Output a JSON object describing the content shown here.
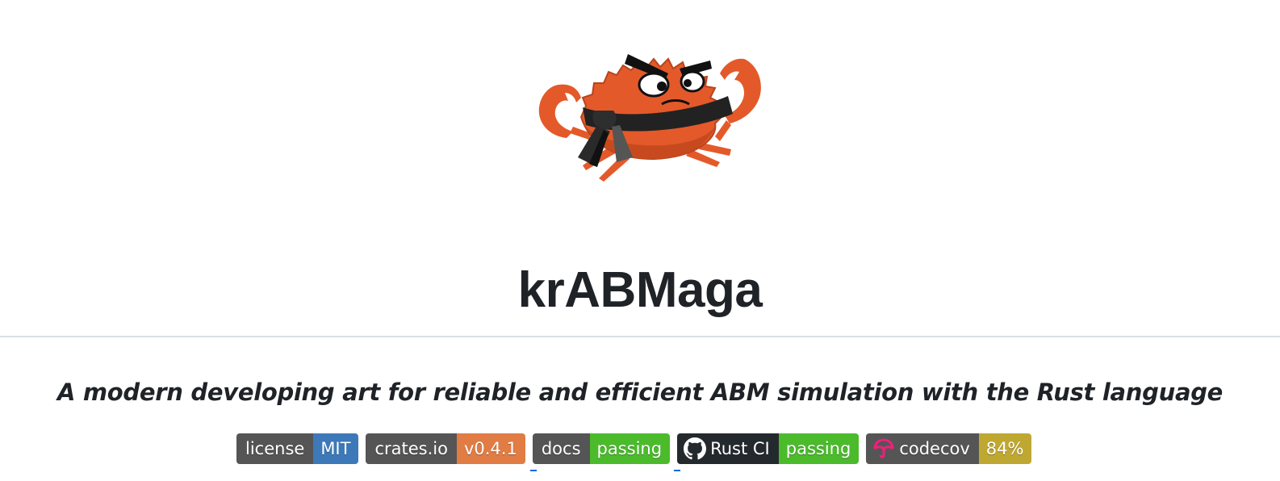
{
  "header": {
    "title": "krABMaga",
    "tagline": "A modern developing art for reliable and efficient ABM simulation with the Rust language"
  },
  "logo": {
    "icon": "ferris-crab-black-belt-icon",
    "body_color": "#e4592a",
    "belt_color": "#222222"
  },
  "badges": [
    {
      "label": "license",
      "message": "MIT",
      "message_color": "#3d79b8",
      "icon": ""
    },
    {
      "label": "crates.io",
      "message": "v0.4.1",
      "message_color": "#e07c44",
      "icon": ""
    },
    {
      "label": "docs",
      "message": "passing",
      "message_color": "#4bbb2c",
      "icon": ""
    },
    {
      "label": "Rust CI",
      "message": "passing",
      "message_color": "#4bbb2c",
      "icon": "github-icon",
      "label_color": "#24292e"
    },
    {
      "label": "codecov",
      "message": "84%",
      "message_color": "#bfa832",
      "icon": "codecov-umbrella-icon"
    }
  ]
}
